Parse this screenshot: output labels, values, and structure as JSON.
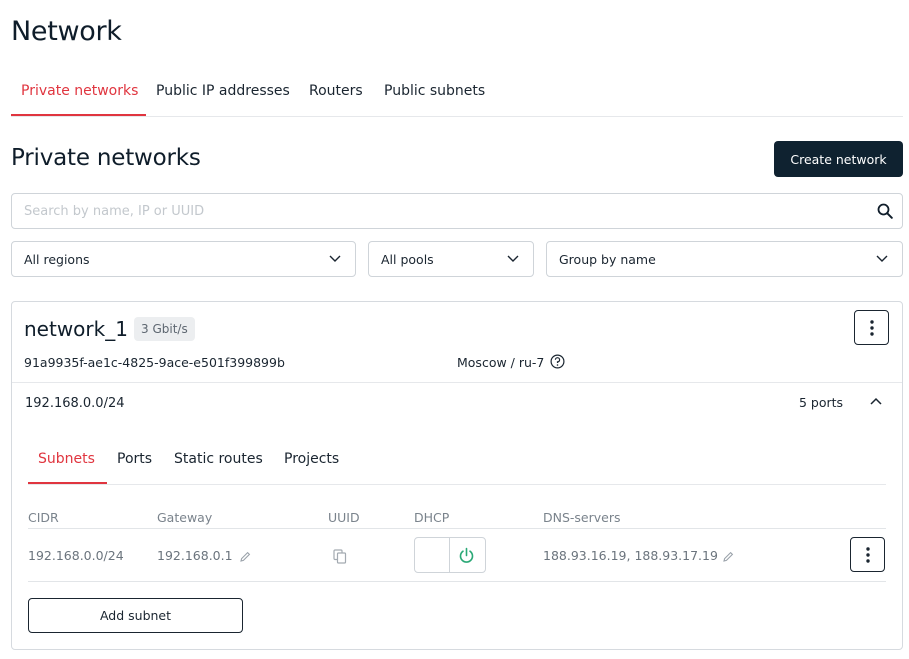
{
  "page": {
    "title": "Network"
  },
  "tabs": [
    {
      "label": "Private networks",
      "active": true
    },
    {
      "label": "Public IP addresses",
      "active": false
    },
    {
      "label": "Routers",
      "active": false
    },
    {
      "label": "Public subnets",
      "active": false
    }
  ],
  "section": {
    "title": "Private networks",
    "create_button": "Create network"
  },
  "search": {
    "placeholder": "Search by name, IP or UUID",
    "value": ""
  },
  "filters": {
    "region": "All regions",
    "pool": "All pools",
    "group": "Group by name"
  },
  "network": {
    "name": "network_1",
    "speed": "3 Gbit/s",
    "uuid": "91a9935f-ae1c-4825-9ace-e501f399899b",
    "region": "Moscow / ru-7",
    "subnet_cidr": "192.168.0.0/24",
    "ports_count": "5 ports",
    "inner_tabs": [
      {
        "label": "Subnets",
        "active": true
      },
      {
        "label": "Ports",
        "active": false
      },
      {
        "label": "Static routes",
        "active": false
      },
      {
        "label": "Projects",
        "active": false
      }
    ],
    "table": {
      "headers": [
        "CIDR",
        "Gateway",
        "UUID",
        "DHCP",
        "DNS-servers"
      ],
      "rows": [
        {
          "cidr": "192.168.0.0/24",
          "gateway": "192.168.0.1",
          "dns": "188.93.16.19, 188.93.17.19",
          "dhcp_enabled": true
        }
      ]
    },
    "add_subnet_button": "Add subnet"
  },
  "colors": {
    "accent": "#e0353f",
    "primary_dark": "#0f2230",
    "dhcp_on": "#2aa876"
  }
}
